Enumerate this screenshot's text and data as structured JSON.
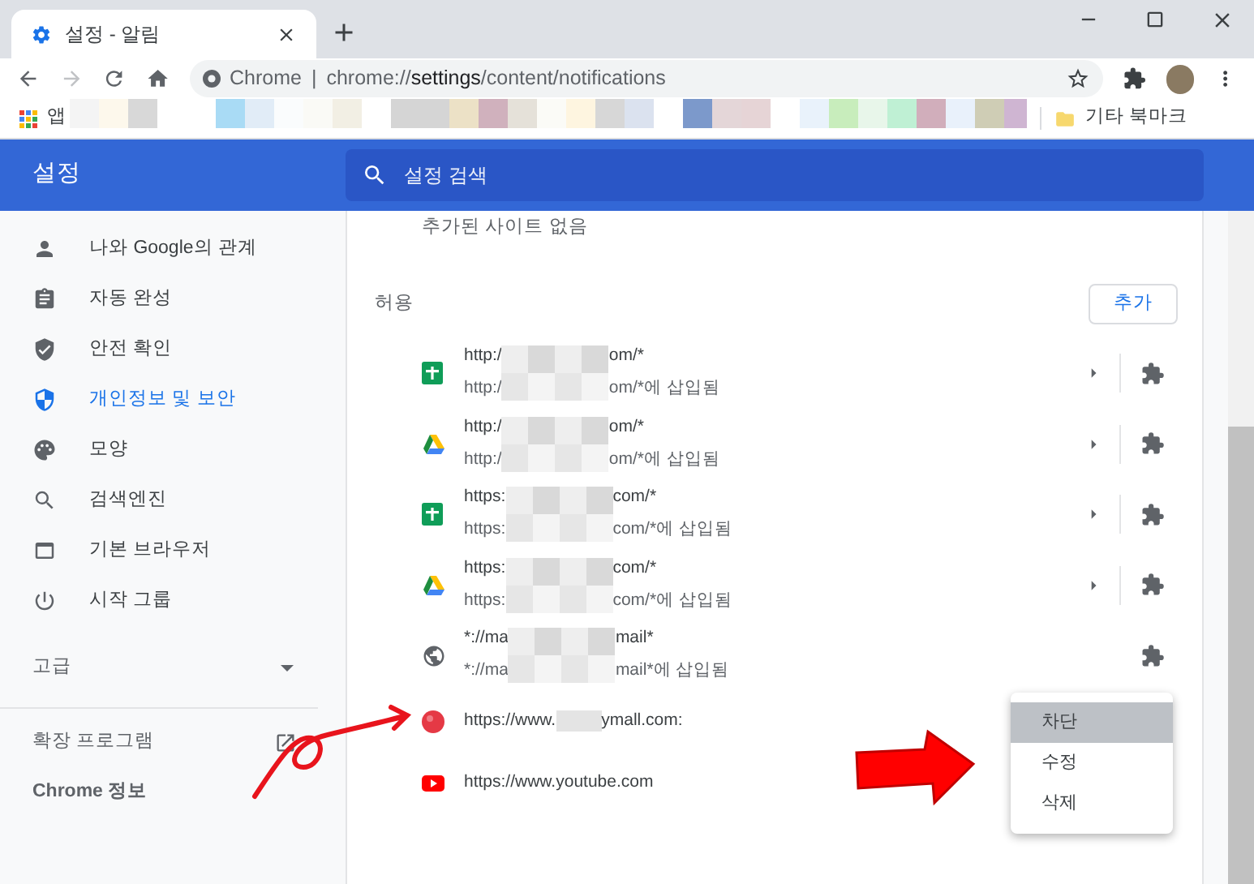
{
  "tab": {
    "title": "설정 - 알림"
  },
  "address_bar": {
    "origin_label": "Chrome",
    "separator": "|",
    "url": "chrome://**settings**/content/notifications"
  },
  "bookmarks_bar": {
    "apps_label": "앱",
    "other_bookmarks": "기타 북마크"
  },
  "header": {
    "title": "설정",
    "search_placeholder": "설정 검색"
  },
  "sidebar": {
    "items": [
      {
        "label": "나와 Google의 관계",
        "selected": false
      },
      {
        "label": "자동 완성",
        "selected": false
      },
      {
        "label": "안전 확인",
        "selected": false
      },
      {
        "label": "개인정보 및 보안",
        "selected": true
      },
      {
        "label": "모양",
        "selected": false
      },
      {
        "label": "검색엔진",
        "selected": false
      },
      {
        "label": "기본 브라우저",
        "selected": false
      },
      {
        "label": "시작 그룹",
        "selected": false
      }
    ],
    "advanced": {
      "label": "고급",
      "expanded": false
    },
    "links": [
      {
        "label": "확장 프로그램",
        "external": true
      },
      {
        "label": "Chrome 정보",
        "external": false
      }
    ]
  },
  "content": {
    "empty_note": "추가된 사이트 없음",
    "allow_heading": "허용",
    "add_button": "추가",
    "sites": [
      {
        "url": [
          "http:/",
          "om/*"
        ],
        "embedded": [
          "http:/",
          "om/*에 삽입됨"
        ],
        "expandable": true,
        "extension": true
      },
      {
        "url": [
          "http:/",
          "om/*"
        ],
        "embedded": [
          "http:/",
          "om/*에 삽입됨"
        ],
        "expandable": true,
        "extension": true
      },
      {
        "url": [
          "https:",
          "com/*"
        ],
        "embedded": [
          "https:",
          "com/*에 삽입됨"
        ],
        "expandable": true,
        "extension": true
      },
      {
        "url": [
          "https:",
          "com/*"
        ],
        "embedded": [
          "https:",
          "com/*에 삽입됨"
        ],
        "expandable": true,
        "extension": true
      },
      {
        "url": [
          "*://ma",
          "mail*"
        ],
        "embedded": [
          "*://ma",
          "mail*에 삽입됨"
        ],
        "expandable": false,
        "extension": true
      },
      {
        "url": [
          "https://www.",
          "ymall.com:"
        ]
      },
      {
        "url": [
          "https://www.youtube.com"
        ]
      }
    ]
  },
  "context_menu": {
    "items": [
      {
        "label": "차단",
        "selected": true
      },
      {
        "label": "수정",
        "selected": false
      },
      {
        "label": "삭제",
        "selected": false
      }
    ]
  }
}
